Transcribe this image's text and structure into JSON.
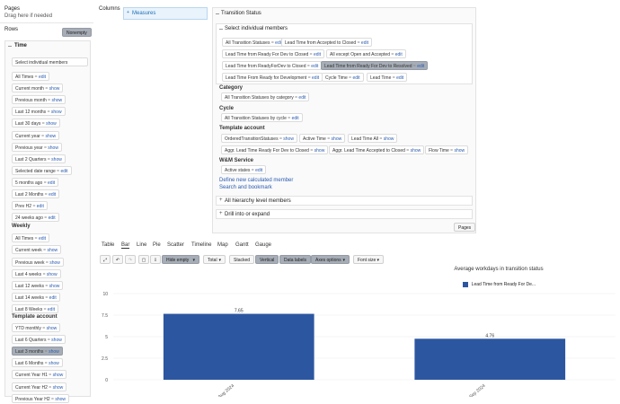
{
  "pages": {
    "title": "Pages",
    "hint": "Drag here if needed"
  },
  "rows": {
    "title": "Rows",
    "button": "Nonempty"
  },
  "time": {
    "title": "Time",
    "select_label": "Select individual members"
  },
  "columns": {
    "title": "Columns",
    "measures": "Measures"
  },
  "edit": "edit",
  "show": "show",
  "time_members": [
    {
      "label": "All Times",
      "action": "edit"
    },
    {
      "label": "Current month",
      "action": "show"
    },
    {
      "label": "Previous month",
      "action": "show"
    },
    {
      "label": "Last 12 months",
      "action": "show"
    },
    {
      "label": "Last 30 days",
      "action": "show"
    },
    {
      "label": "Current year",
      "action": "show"
    },
    {
      "label": "Previous year",
      "action": "show"
    },
    {
      "label": "Last 2 Quarters",
      "action": "show"
    },
    {
      "label": "Selected date range",
      "action": "edit"
    },
    {
      "label": "5 months ago",
      "action": "edit"
    },
    {
      "label": "Last 2 Months",
      "action": "edit"
    },
    {
      "label": "Prev H2",
      "action": "edit"
    },
    {
      "label": "24 weeks ago",
      "action": "edit"
    }
  ],
  "weekly": {
    "title": "Weekly",
    "items": [
      {
        "label": "All Times",
        "action": "edit"
      },
      {
        "label": "Current week",
        "action": "show"
      },
      {
        "label": "Previous week",
        "action": "show"
      },
      {
        "label": "Last 4 weeks",
        "action": "show"
      },
      {
        "label": "Last 12 weeks",
        "action": "show"
      },
      {
        "label": "Last 14 weeks",
        "action": "edit"
      },
      {
        "label": "Last 8 Weeks",
        "action": "edit"
      }
    ]
  },
  "template_account_left": {
    "title": "Template account",
    "items": [
      {
        "label": "YTD monthly",
        "action": "show"
      },
      {
        "label": "Last 6 Quarters",
        "action": "show"
      },
      {
        "label": "Last 3 months",
        "action": "show"
      },
      {
        "label": "Last 6 Months",
        "action": "show"
      },
      {
        "label": "Current Year H1",
        "action": "show"
      },
      {
        "label": "Current Year H2",
        "action": "show"
      },
      {
        "label": "Previous Year H2",
        "action": "show"
      }
    ]
  },
  "transition": {
    "title": "Transition Status",
    "select_label": "Select individual members",
    "members": [
      {
        "label": "All Transition Statuses",
        "action": "edit"
      },
      {
        "label": "Lead Time from Accepted to Closed",
        "action": "edit"
      },
      {
        "label": "Lead Time from Ready For Dev to Closed",
        "action": "edit"
      },
      {
        "label": "All except Open and Accepted",
        "action": "edit"
      },
      {
        "label": "Lead Time from ReadyForDev to Closed",
        "action": "edit"
      },
      {
        "label": "Lead Time from Ready For Dev to Resolved",
        "action": "edit"
      },
      {
        "label": "Lead Time From Ready for Development",
        "action": "edit"
      },
      {
        "label": "Cycle Time",
        "action": "edit"
      },
      {
        "label": "Lead Time",
        "action": "edit"
      }
    ],
    "category": {
      "title": "Category",
      "items": [
        {
          "label": "All Transition Statuses by category",
          "action": "edit"
        }
      ]
    },
    "cycle": {
      "title": "Cycle",
      "items": [
        {
          "label": "All Transition Statuses by cycle",
          "action": "edit"
        }
      ]
    },
    "template_account": {
      "title": "Template account",
      "items": [
        {
          "label": "OrderedTransitionStatuses",
          "action": "show"
        },
        {
          "label": "Active Time",
          "action": "show"
        },
        {
          "label": "Lead Time All",
          "action": "show"
        },
        {
          "label": "Aggr. Lead Time Ready For Dev to Closed",
          "action": "show"
        },
        {
          "label": "Aggr. Lead Time Accepted to Closed",
          "action": "show"
        },
        {
          "label": "Flow Time",
          "action": "show"
        }
      ]
    },
    "wm": {
      "title": "W&M Service",
      "items": [
        {
          "label": "Active states",
          "action": "edit"
        }
      ]
    },
    "define_link": "Define new calculated member",
    "search_link": "Search and bookmark",
    "hierarchy": "All hierarchy level members",
    "drill": "Drill into or expand",
    "pages_button": "Pages"
  },
  "chart_tabs": [
    "Table",
    "Bar",
    "Line",
    "Pie",
    "Scatter",
    "Timeline",
    "Map",
    "Gantt",
    "Gauge"
  ],
  "toolbar": {
    "hide_empty": "Hide empty",
    "total": "Total",
    "stacked": "Stacked",
    "vertical": "Vertical",
    "data_labels": "Data labels",
    "axes_options": "Axes options",
    "font_size": "Font size"
  },
  "chart_data": {
    "type": "bar",
    "title": "Average workdays in transition status",
    "categories": [
      "Aug 2024",
      "Sep 2024"
    ],
    "series": [
      {
        "name": "Lead Time from Ready For De...",
        "values": [
          7.65,
          4.76
        ],
        "color": "#2c56a0"
      }
    ],
    "data_labels": [
      "7.65",
      "4.76"
    ],
    "yticks": [
      "10",
      "7.5",
      "5",
      "2.5",
      "0"
    ],
    "ylim": [
      0,
      10
    ]
  }
}
